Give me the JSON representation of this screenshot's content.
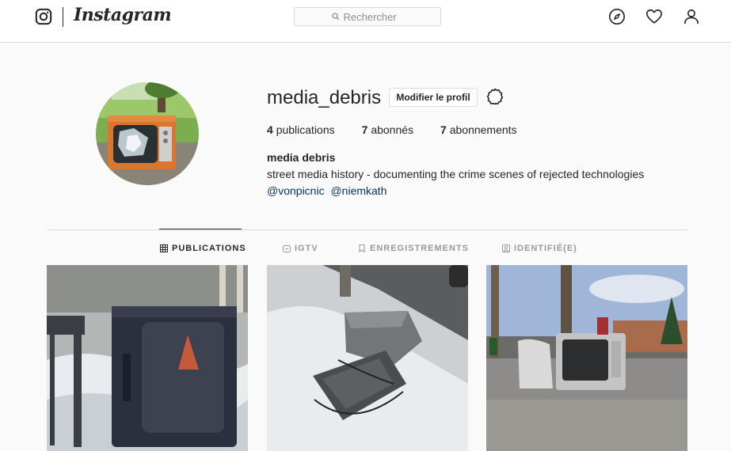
{
  "app": {
    "wordmark": "Instagram"
  },
  "search": {
    "placeholder": "Rechercher"
  },
  "nav": {
    "icons": [
      "instagram-glyph-icon",
      "compass-icon",
      "heart-icon",
      "user-icon"
    ]
  },
  "profile": {
    "username": "media_debris",
    "edit_button": "Modifier le profil",
    "stats": [
      {
        "count": "4",
        "label": "publications"
      },
      {
        "count": "7",
        "label": "abonnés"
      },
      {
        "count": "7",
        "label": "abonnements"
      }
    ],
    "full_name": "media debris",
    "bio": "street media history - documenting the crime scenes of rejected technologies",
    "mentions": [
      "@vonpicnic",
      "@niemkath"
    ]
  },
  "tabs": [
    {
      "label": "PUBLICATIONS",
      "icon": "grid-icon",
      "active": true
    },
    {
      "label": "IGTV",
      "icon": "igtv-icon",
      "active": false
    },
    {
      "label": "ENREGISTREMENTS",
      "icon": "bookmark-icon",
      "active": false
    },
    {
      "label": "IDENTIFIÉ(E)",
      "icon": "tagged-icon",
      "active": false
    }
  ],
  "colors": {
    "link": "#003569",
    "border": "#dbdbdb",
    "text": "#262626",
    "muted": "#999999"
  }
}
